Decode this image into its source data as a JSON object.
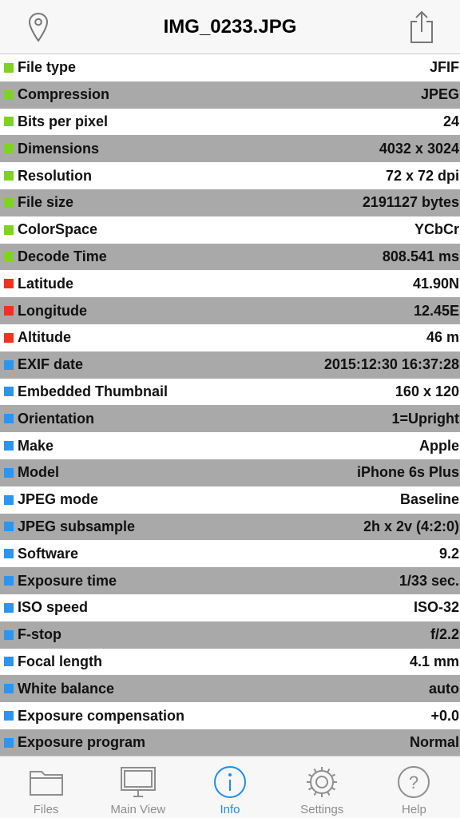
{
  "header": {
    "title": "IMG_0233.JPG",
    "left_icon": "location-pin-icon",
    "right_icon": "share-icon"
  },
  "colors": {
    "green": "#7ed321",
    "red": "#f0321e",
    "blue": "#2b95f0",
    "stripe": "#a9a9a9",
    "accent": "#1e8cf0"
  },
  "rows": [
    {
      "label": "File type",
      "value": "JFIF",
      "category": "green"
    },
    {
      "label": "Compression",
      "value": "JPEG",
      "category": "green"
    },
    {
      "label": "Bits per pixel",
      "value": "24",
      "category": "green"
    },
    {
      "label": "Dimensions",
      "value": "4032 x 3024",
      "category": "green"
    },
    {
      "label": "Resolution",
      "value": "72 x 72 dpi",
      "category": "green"
    },
    {
      "label": "File size",
      "value": "2191127 bytes",
      "category": "green"
    },
    {
      "label": "ColorSpace",
      "value": "YCbCr",
      "category": "green"
    },
    {
      "label": "Decode Time",
      "value": "808.541 ms",
      "category": "green"
    },
    {
      "label": "Latitude",
      "value": "41.90N",
      "category": "red"
    },
    {
      "label": "Longitude",
      "value": "12.45E",
      "category": "red"
    },
    {
      "label": "Altitude",
      "value": "46 m",
      "category": "red"
    },
    {
      "label": "EXIF date",
      "value": "2015:12:30 16:37:28",
      "category": "blue"
    },
    {
      "label": "Embedded Thumbnail",
      "value": "160 x 120",
      "category": "blue"
    },
    {
      "label": "Orientation",
      "value": "1=Upright",
      "category": "blue"
    },
    {
      "label": "Make",
      "value": "Apple",
      "category": "blue"
    },
    {
      "label": "Model",
      "value": "iPhone 6s Plus",
      "category": "blue"
    },
    {
      "label": "JPEG mode",
      "value": "Baseline",
      "category": "blue"
    },
    {
      "label": "JPEG subsample",
      "value": "2h x 2v (4:2:0)",
      "category": "blue"
    },
    {
      "label": "Software",
      "value": "9.2",
      "category": "blue"
    },
    {
      "label": "Exposure time",
      "value": "1/33 sec.",
      "category": "blue"
    },
    {
      "label": "ISO speed",
      "value": "ISO-32",
      "category": "blue"
    },
    {
      "label": "F-stop",
      "value": "f/2.2",
      "category": "blue"
    },
    {
      "label": "Focal length",
      "value": "4.1 mm",
      "category": "blue"
    },
    {
      "label": "White balance",
      "value": "auto",
      "category": "blue"
    },
    {
      "label": "Exposure compensation",
      "value": "+0.0",
      "category": "blue"
    },
    {
      "label": "Exposure program",
      "value": "Normal",
      "category": "blue"
    }
  ],
  "tabs": [
    {
      "label": "Files",
      "icon": "folder-icon",
      "active": false
    },
    {
      "label": "Main View",
      "icon": "monitor-icon",
      "active": false
    },
    {
      "label": "Info",
      "icon": "info-icon",
      "active": true
    },
    {
      "label": "Settings",
      "icon": "gear-icon",
      "active": false
    },
    {
      "label": "Help",
      "icon": "help-icon",
      "active": false
    }
  ]
}
